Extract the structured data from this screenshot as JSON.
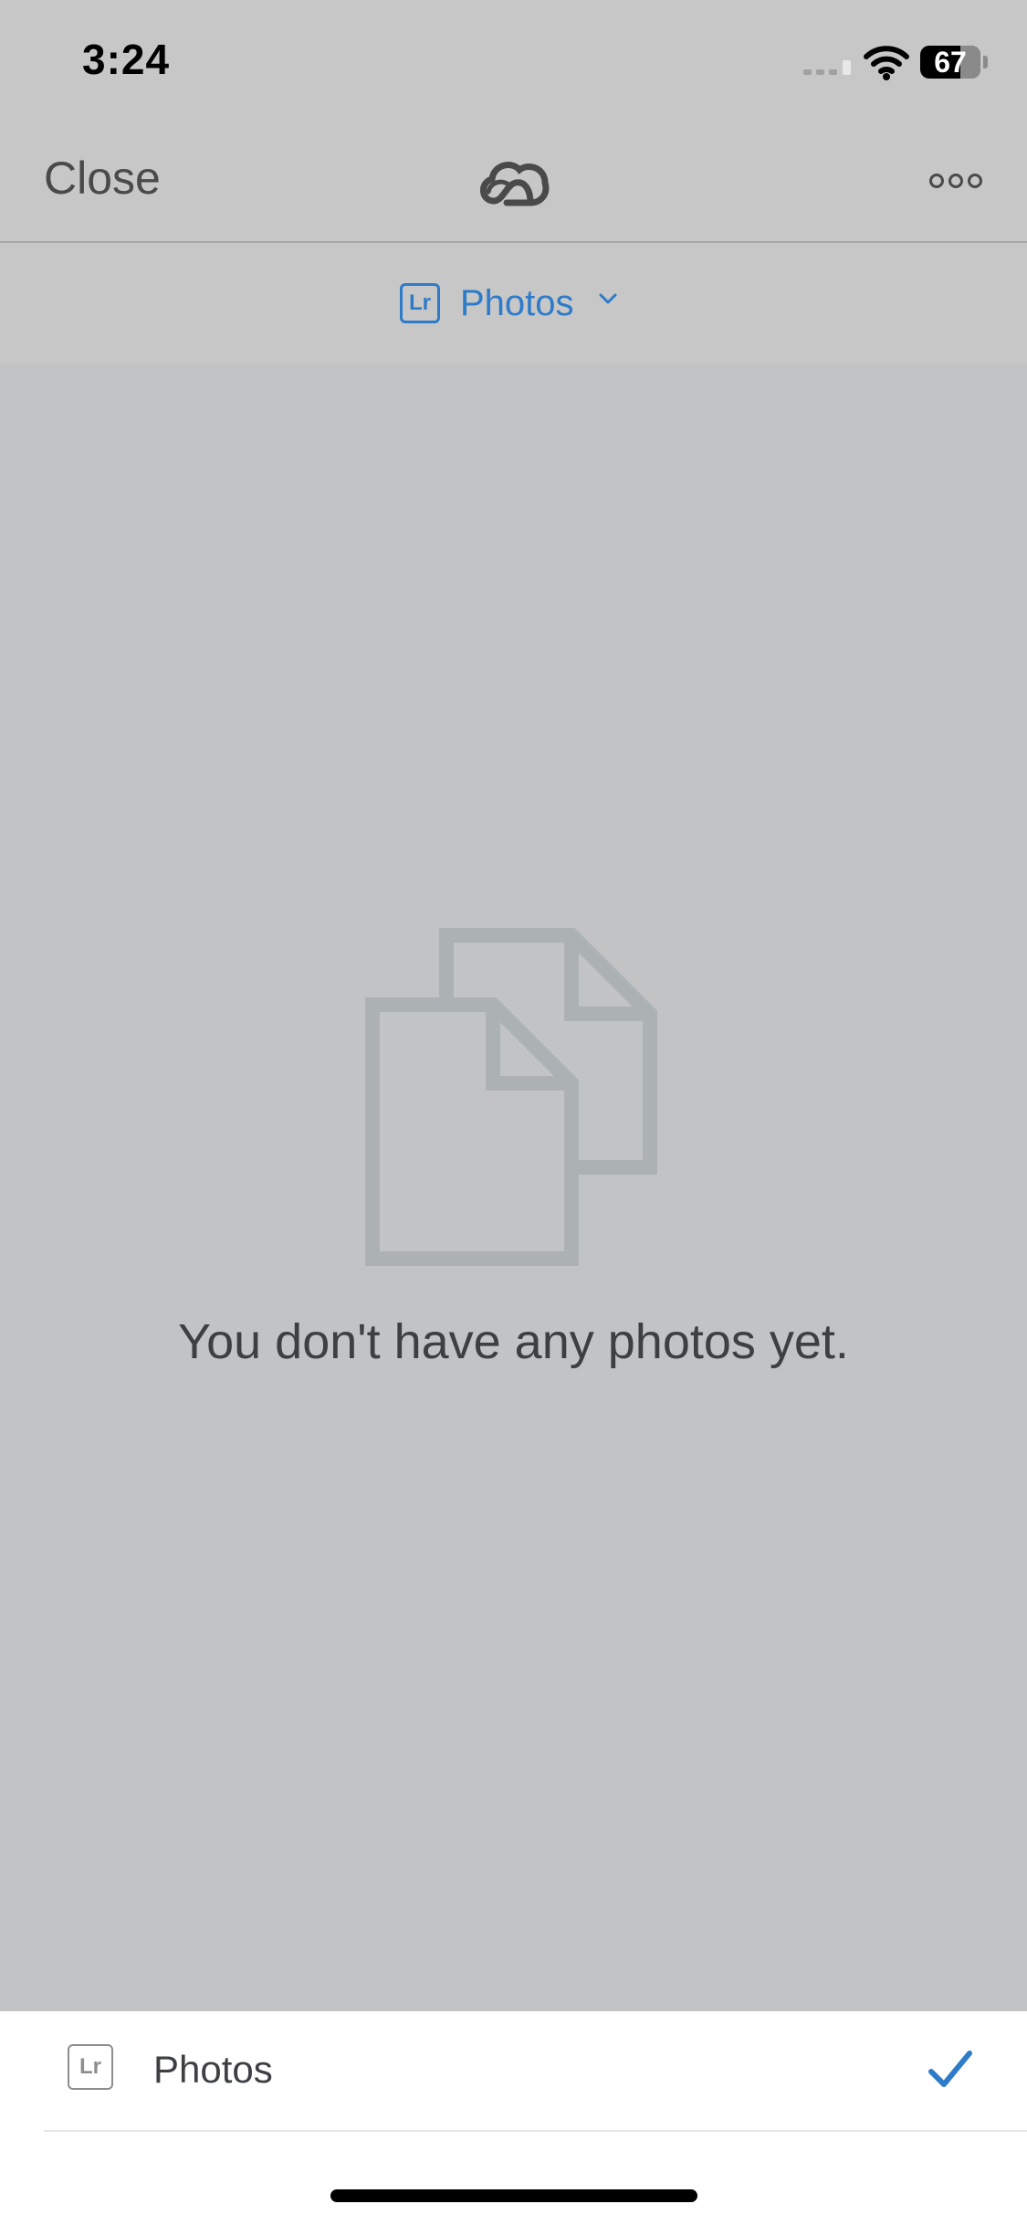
{
  "status_bar": {
    "time": "3:24",
    "battery_level": "67"
  },
  "nav": {
    "close_label": "Close"
  },
  "source_selector": {
    "badge": "Lr",
    "label": "Photos"
  },
  "empty_state": {
    "message": "You don't have any photos yet."
  },
  "sheet": {
    "items": [
      {
        "badge": "Lr",
        "label": "Photos",
        "selected": true
      }
    ]
  },
  "icons": {
    "cloud": "creative-cloud-icon",
    "more": "more-icon",
    "chevron": "chevron-down-icon",
    "empty": "empty-documents-icon",
    "check": "checkmark-icon"
  },
  "colors": {
    "accent": "#2d7bc9",
    "background": "#c2c3c5",
    "bar": "#c7c7c7",
    "text": "#3d3f43",
    "sheet": "#ffffff"
  }
}
